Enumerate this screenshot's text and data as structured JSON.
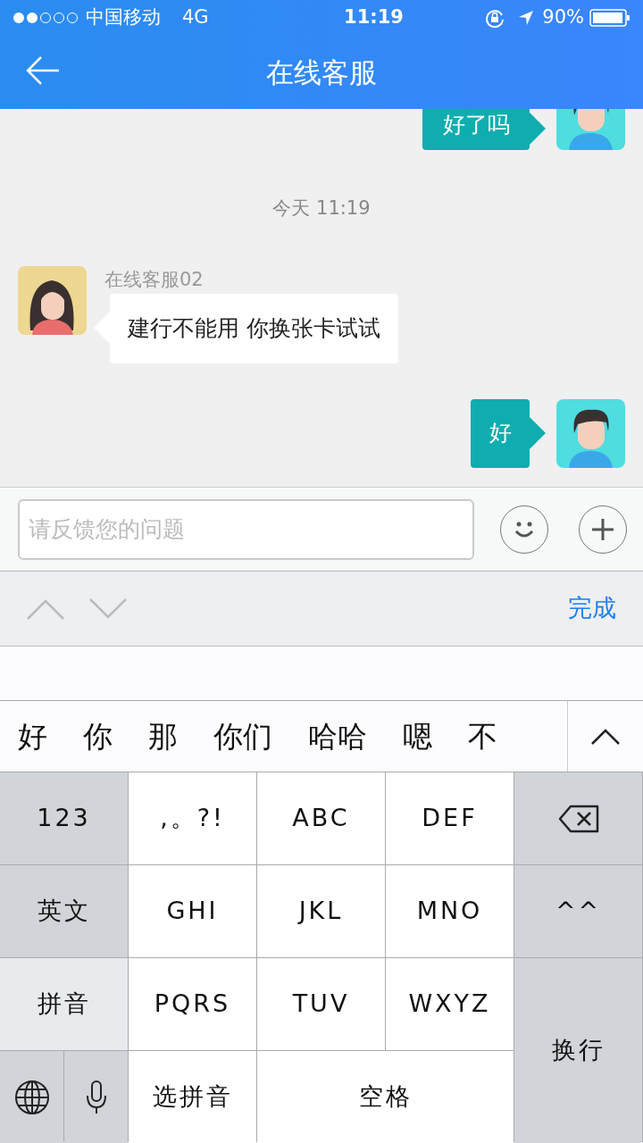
{
  "status_bar": {
    "carrier": "中国移动",
    "network": "4G",
    "time": "11:19",
    "battery": "90%"
  },
  "nav": {
    "title": "在线客服"
  },
  "messages": [
    {
      "kind": "outgoing",
      "text": "好了吗"
    },
    {
      "kind": "time",
      "text": "今天 11:19"
    },
    {
      "kind": "incoming",
      "sender": "在线客服02",
      "text": "建行不能用 你换张卡试试"
    },
    {
      "kind": "outgoing",
      "text": "好"
    }
  ],
  "input": {
    "placeholder": "请反馈您的问题"
  },
  "toolbar": {
    "done": "完成"
  },
  "candidates": [
    "好",
    "你",
    "那",
    "你们",
    "哈哈",
    "嗯",
    "不"
  ],
  "keys": [
    {
      "kind": "function",
      "label": "123"
    },
    {
      "kind": "letter",
      "label": ",。?!"
    },
    {
      "kind": "letter",
      "label": "ABC"
    },
    {
      "kind": "letter",
      "label": "DEF"
    },
    {
      "kind": "delete"
    },
    {
      "kind": "mode",
      "label": "英文",
      "selected": false
    },
    {
      "kind": "letter",
      "label": "GHI"
    },
    {
      "kind": "letter",
      "label": "JKL"
    },
    {
      "kind": "letter",
      "label": "MNO"
    },
    {
      "kind": "function",
      "label": "^^"
    },
    {
      "kind": "mode",
      "label": "拼音",
      "selected": true
    },
    {
      "kind": "letter",
      "label": "PQRS"
    },
    {
      "kind": "letter",
      "label": "TUV"
    },
    {
      "kind": "letter",
      "label": "WXYZ"
    },
    {
      "kind": "return",
      "label": "换行"
    },
    {
      "kind": "globe"
    },
    {
      "kind": "mic"
    },
    {
      "kind": "letter",
      "label": "选拼音"
    },
    {
      "kind": "space",
      "label": "空格"
    }
  ]
}
